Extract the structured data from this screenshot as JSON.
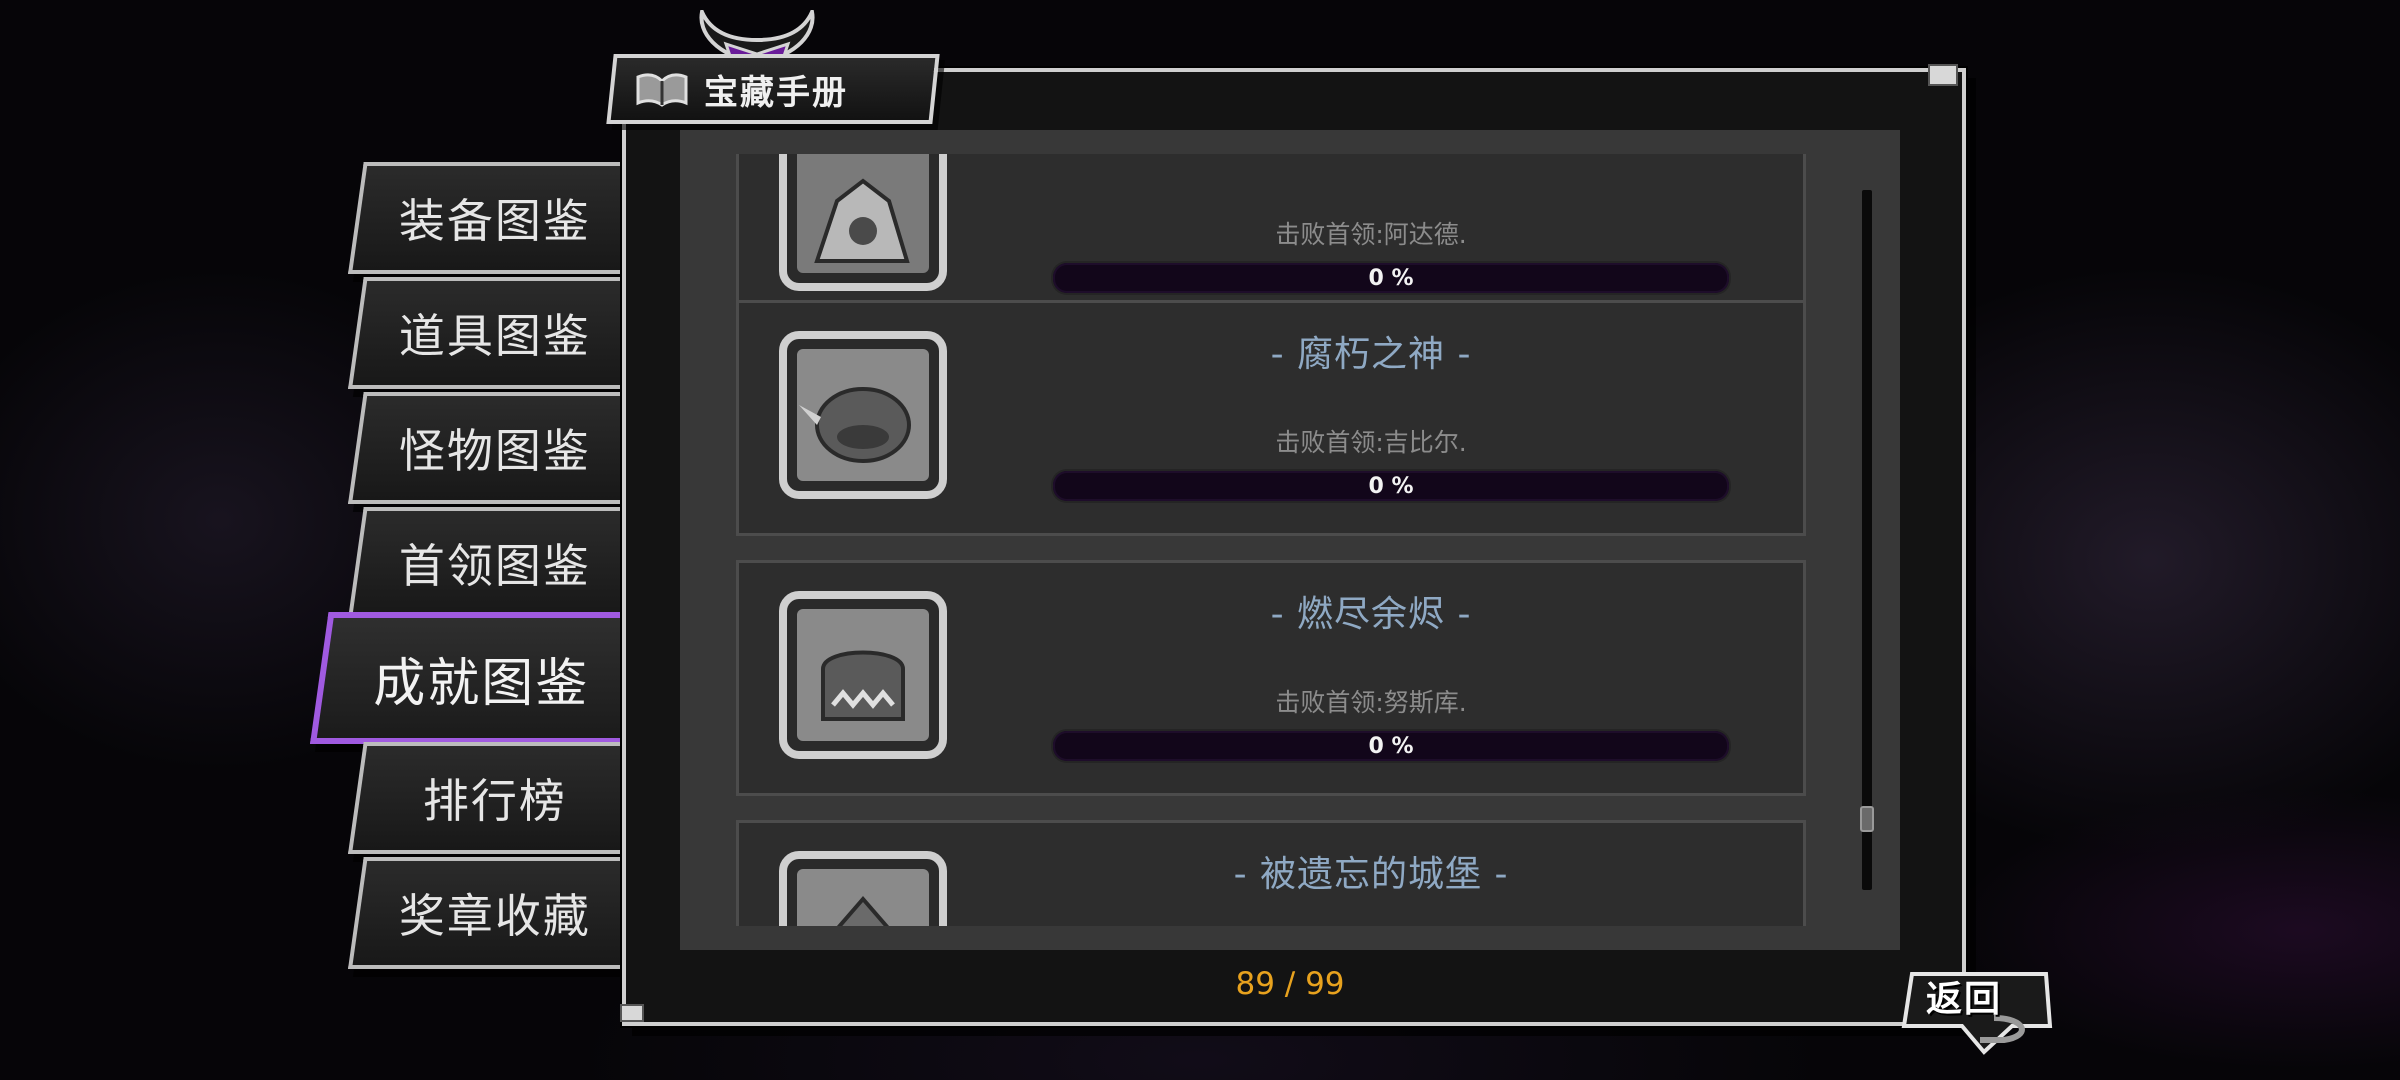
{
  "header": {
    "title": "宝藏手册",
    "icon": "book-icon"
  },
  "sidebar": {
    "tabs": [
      {
        "label": "装备图鉴",
        "active": false
      },
      {
        "label": "道具图鉴",
        "active": false
      },
      {
        "label": "怪物图鉴",
        "active": false
      },
      {
        "label": "首领图鉴",
        "active": false
      },
      {
        "label": "成就图鉴",
        "active": true
      },
      {
        "label": "排行榜",
        "active": false
      },
      {
        "label": "奖章收藏",
        "active": false
      }
    ]
  },
  "achievements": [
    {
      "title": "",
      "description": "击败首领:阿达德.",
      "progress": 0,
      "progress_label": "0 %",
      "icon": "boss-icon"
    },
    {
      "title": "- 腐朽之神 -",
      "description": "击败首领:吉比尔.",
      "progress": 0,
      "progress_label": "0 %",
      "icon": "boss-icon"
    },
    {
      "title": "- 燃尽余烬 -",
      "description": "击败首领:努斯库.",
      "progress": 0,
      "progress_label": "0 %",
      "icon": "boss-icon"
    },
    {
      "title": "- 被遗忘的城堡 -",
      "description": "",
      "progress": 0,
      "progress_label": "",
      "icon": "boss-icon"
    }
  ],
  "pagination": {
    "label": "89 / 99"
  },
  "back_button": {
    "label": "返回"
  },
  "colors": {
    "accent": "#a05ae0",
    "title": "#8fa9c4",
    "counter": "#e8a21e",
    "bar": "#12061a"
  }
}
